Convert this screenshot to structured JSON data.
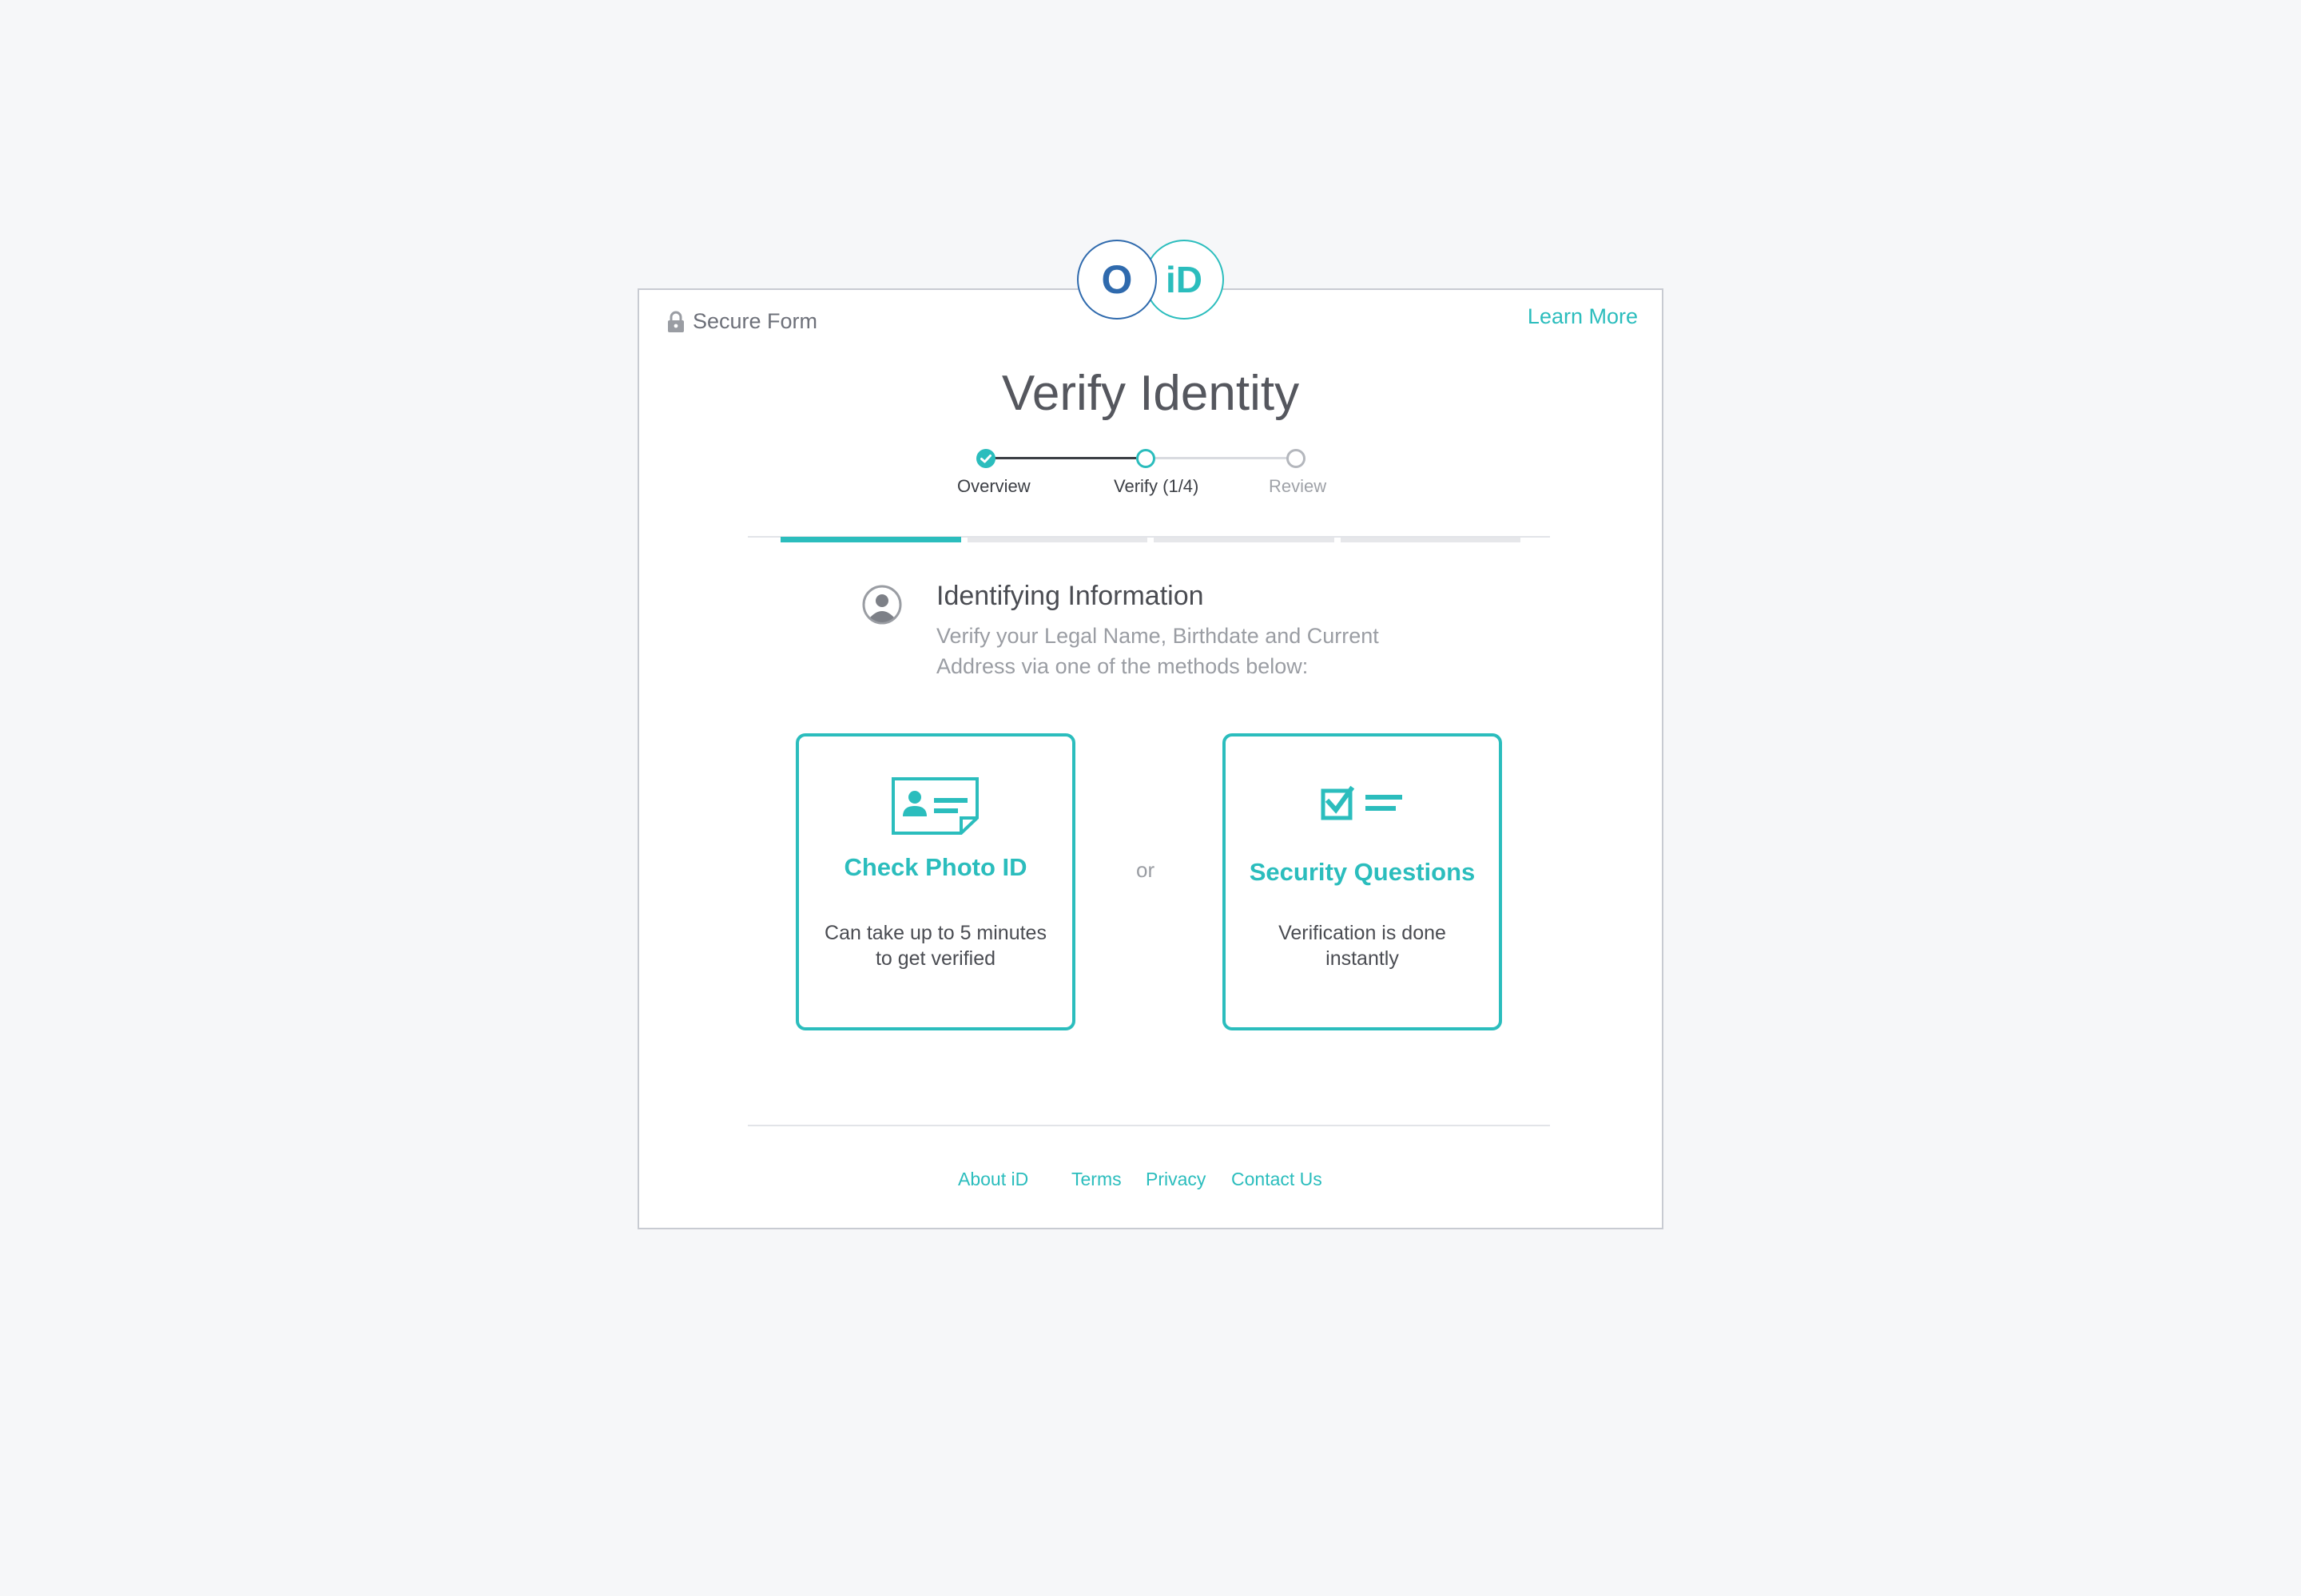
{
  "logo": {
    "left_mark": "O",
    "right_mark": "iD"
  },
  "header": {
    "secure_label": "Secure Form",
    "learn_more": "Learn More"
  },
  "page_title": "Verify Identity",
  "stepper": {
    "steps": [
      {
        "label": "Overview",
        "state": "done"
      },
      {
        "label": "Verify (1/4)",
        "state": "current"
      },
      {
        "label": "Review",
        "state": "todo"
      }
    ]
  },
  "sub_progress": {
    "total_segments": 4,
    "active_segment": 1
  },
  "section": {
    "title": "Identifying Information",
    "description": "Verify your Legal Name, Birthdate and Current Address via one of the methods below:"
  },
  "options": [
    {
      "title": "Check Photo ID",
      "description": "Can take up to 5 minutes to get verified",
      "icon": "photo-id-card-icon"
    },
    {
      "title": "Security Questions",
      "description": "Verification is done instantly",
      "icon": "checklist-icon"
    }
  ],
  "separator": "or",
  "footer": {
    "about": "About iD",
    "terms": "Terms",
    "privacy": "Privacy",
    "contact": "Contact Us"
  },
  "colors": {
    "accent": "#2bbdbd",
    "brand_blue": "#2f6aad",
    "background": "#f6f7f9"
  }
}
